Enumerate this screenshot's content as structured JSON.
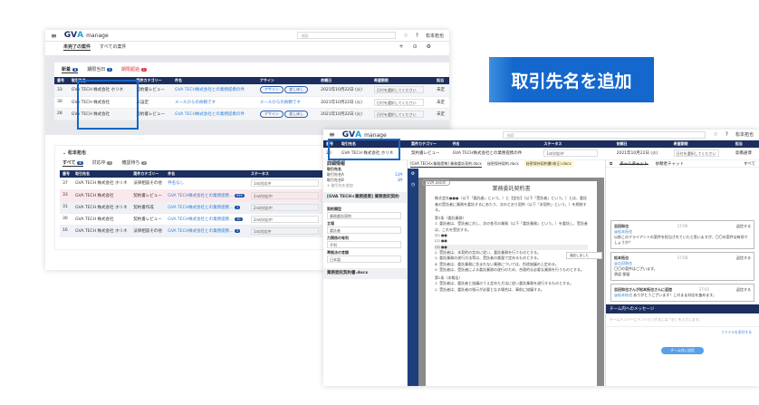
{
  "app": {
    "name_main": "GV",
    "name_accent": "A",
    "name_sub": "manage",
    "search_placeholder": "検索",
    "user": "松本拓也"
  },
  "back": {
    "tabs": [
      "未完了の案件",
      "すべての案件"
    ],
    "subtabs": [
      {
        "label": "新着",
        "count": "3"
      },
      {
        "label": "期限当日",
        "count": "0"
      },
      {
        "label": "期限超過",
        "count": "2"
      }
    ],
    "columns": [
      "番号",
      "取引先名",
      "案件カテゴリー",
      "件名",
      "アサイン",
      "依頼日",
      "希望期限",
      "担当"
    ],
    "rows": [
      {
        "no": "33",
        "client": "GVA TECH 株式会社",
        "tag": "ホリネ",
        "cat": "契約書レビュー",
        "title": "GVA TECH株式会社との業務提携の件",
        "assign": "アサイン",
        "return": "差し戻し",
        "date": "2021年10月22日 (火)",
        "due": "日付を選択してください",
        "who": "未定"
      },
      {
        "no": "30",
        "client": "GVA TECH 株式会社",
        "tag": "",
        "cat": "未設定",
        "title": "メールからの依頼です",
        "assign": "メールからの依頼です",
        "return": "",
        "date": "2021年10月22日 (火)",
        "due": "日付を選択してください",
        "who": "未定"
      },
      {
        "no": "28",
        "client": "GVA TECH 株式会社",
        "tag": "",
        "cat": "契約書レビュー",
        "title": "GVA TECH株式会社との業務提携の件",
        "assign": "アサイン",
        "return": "差し戻し",
        "date": "2021年10月22日 (火)",
        "due": "日付を選択してください",
        "who": "未定"
      }
    ],
    "section2": {
      "title": "松本拓也",
      "tabs": [
        {
          "label": "すべて",
          "count": "5"
        },
        {
          "label": "対応中",
          "count": "3"
        },
        {
          "label": "確認待ち",
          "count": "2"
        }
      ],
      "columns": [
        "番号",
        "取引先名",
        "案件カテゴリー",
        "件名",
        "ステータス"
      ],
      "rows": [
        {
          "no": "37",
          "client": "GVA TECH 株式会社",
          "tag": "ホリネ",
          "cat": "法律相談その他",
          "title": "件名なし",
          "badge": "",
          "status": "1st/対応中"
        },
        {
          "no": "33",
          "client": "GVA TECH 株式会社",
          "tag": "",
          "cat": "契約書レビュー",
          "title": "GVA TECH株式会社との業務提携…",
          "badge": "999",
          "status": "2nd/対応中"
        },
        {
          "no": "31",
          "client": "GVA TECH 株式会社",
          "tag": "ホリネ",
          "cat": "契約書作成",
          "title": "GVA TECH株式会社との業務提携…",
          "badge": "1",
          "status": "2nd/対応中"
        },
        {
          "no": "30",
          "client": "GVA TECH 株式会社",
          "tag": "",
          "cat": "契約書レビュー",
          "title": "GVA TECH株式会社との業務提携…",
          "badge": "10",
          "status": "2nd/対応中"
        },
        {
          "no": "16",
          "client": "GVA TECH 株式会社",
          "tag": "ホリネ",
          "cat": "法律相談その他",
          "title": "GVA TECH株式会社との業務提携…",
          "badge": "3",
          "status": "1st/対応中"
        }
      ]
    }
  },
  "callout": "取引先名を追加",
  "front": {
    "columns": [
      "番号",
      "取引先名",
      "案件カテゴリー",
      "件名",
      "ステータス",
      "依頼日",
      "希望期限",
      "担当"
    ],
    "row": {
      "no": "20",
      "client": "GVA TECH 株式会社",
      "tag": "ホリネ",
      "cat": "契約書レビュー",
      "title": "GVA TECH株式会社との業務提携の件",
      "status": "1st/対応中",
      "date": "2021年10月22日 (火)",
      "due": "日付を選択してください",
      "who": "高橋通博"
    },
    "left": {
      "title": "詳細情報",
      "fields": [
        {
          "label": "取引先名",
          "value": "取引先名A",
          "count": "12件"
        },
        {
          "label": "",
          "value": "取引先名B",
          "count": "3件"
        }
      ],
      "add": "+ 取引先を追加",
      "doc1": "[GVA TECH×業務提携] 業務委託契約",
      "doc2": "業務委託契約書.docx",
      "props": [
        {
          "label": "契約類型",
          "value": "業務委託契約"
        },
        {
          "label": "立場",
          "value": "委託者"
        },
        {
          "label": "力関係の有利",
          "value": "不利"
        },
        {
          "label": "準拠法の言語",
          "value": "日本語"
        }
      ]
    },
    "doctabs": [
      "[GVA TECH×業務提携] 業務委託契約.docx",
      "秘密保持契約.docx",
      "秘密保持契約書(修正).docx"
    ],
    "assist": "GVA assist",
    "doc": {
      "title": "業務委託契約書",
      "body": [
        "株式会社●●●（以下「委託者」という。）と【会社】（以下「受託者」という。）とは、委託者の受託者に業務を委託するにあたり、次のとおり契約（以下「本契約」という。）を締結する。",
        "第1条（委託業務）",
        "1. 委託者は、受託者に対し、次の各号の業務（以下「委託業務」という。）を委託し、受託者は、これを受託する。",
        "(1) ●●",
        "(2) ●●",
        "(3) ●●",
        "2. 受託者は、本契約の定めに従い、委託業務を行うものとする。",
        "3. 委託業務の遂行方法等は、受託者の裁量で定めるものとする。",
        "4. 受託者は、委託業務に含まれない業務については、別途協議の上定める。",
        "5. 受託者は、受託者による委託業務の遂行のため、合理的な必要な業務を行うものとする。",
        "第2条（本報告）",
        "1. 受託者は、委託者と協議のうえ定めた方法に従い委託業務を遂行するものとする。",
        "2. 受託者は、委託者の指示が必要となる場合は、事前に協議する。"
      ],
      "comment": "追記しました"
    },
    "chat": {
      "tabs": [
        "チームチャット",
        "依頼者チャット"
      ],
      "all": "すべて",
      "messages": [
        {
          "name": "吉田和也",
          "time": "17:00",
          "reply": "返信する",
          "mention": "@松本拓也",
          "text": "以前このクライアントの案件を担当されていたと思いますが、〇〇の案件は有効でしょうか？"
        },
        {
          "name": "松本拓也",
          "time": "17:00",
          "reply": "返信する",
          "mention": "@吉田和也",
          "text": "〇〇の案件はございます。",
          "extra": "承認 保留"
        },
        {
          "name": "吉田和也さんが松本拓也さんに返信",
          "time": "17:01",
          "reply": "返信する",
          "mention": "@松本拓也",
          "text": "ありがとうございます！このまま対応を進めます。"
        }
      ],
      "compose_title": "チーム内へのメッセージ",
      "compose_placeholder": "チームメンバーにメンションするには「@」を入力します。",
      "attach": "ファイルを添付する",
      "send": "チーム内に送信"
    }
  }
}
